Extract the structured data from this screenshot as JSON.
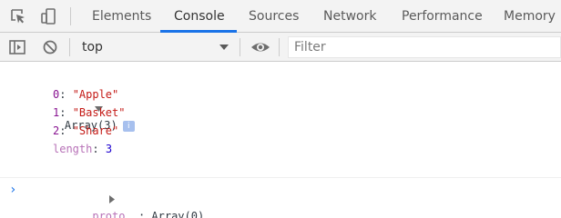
{
  "tabs": [
    {
      "label": "Elements",
      "active": false
    },
    {
      "label": "Console",
      "active": true
    },
    {
      "label": "Sources",
      "active": false
    },
    {
      "label": "Network",
      "active": false
    },
    {
      "label": "Performance",
      "active": false
    },
    {
      "label": "Memory",
      "active": false
    }
  ],
  "toolbar": {
    "context_value": "top",
    "filter_placeholder": "Filter",
    "filter_value": ""
  },
  "output": {
    "array_header": "Array(3)",
    "info_badge": "i",
    "items": [
      {
        "key": "0",
        "value": "\"Apple\""
      },
      {
        "key": "1",
        "value": "\"Basket\""
      },
      {
        "key": "2",
        "value": "\"Share\""
      }
    ],
    "length_key": "length",
    "length_value": "3",
    "proto_key": "__proto__",
    "proto_value": "Array(0)"
  },
  "prompt_symbol": "›",
  "icons": {
    "inspect": "inspect-element-icon",
    "device": "device-toggle-icon",
    "sidebar": "show-sidebar-icon",
    "clear": "clear-console-icon",
    "context": "chevron-down-icon",
    "eye": "live-expression-eye-icon"
  },
  "colors": {
    "accent": "#1a73e8",
    "key": "#881391",
    "string": "#c41a16",
    "number": "#1c00cf",
    "prompt": "#1a73e8"
  }
}
